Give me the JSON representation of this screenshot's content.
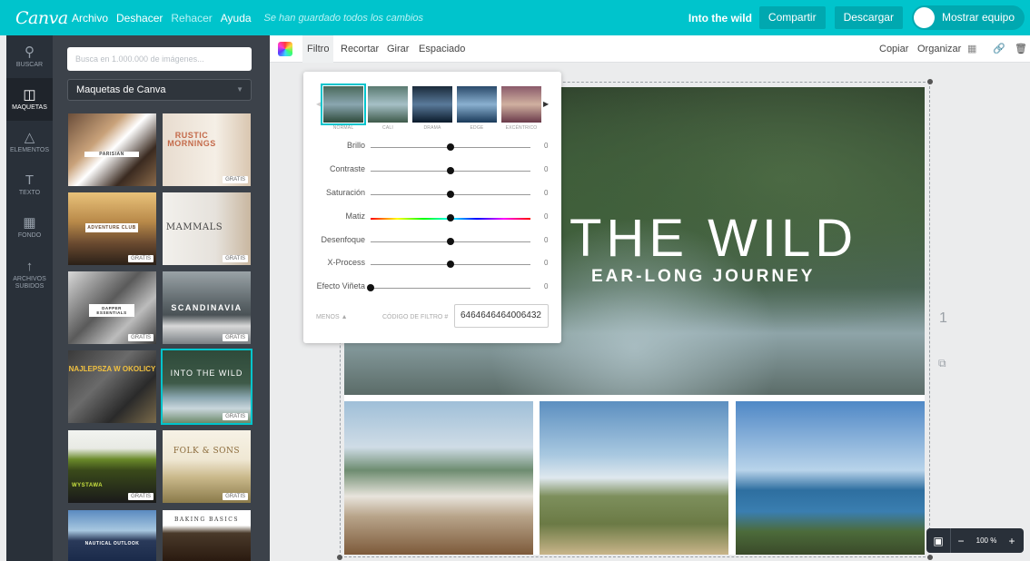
{
  "topbar": {
    "logo": "Canva",
    "menu": [
      "Archivo",
      "Deshacer",
      "Rehacer",
      "Ayuda"
    ],
    "saved_status": "Se han guardado todos los cambios",
    "doc_title": "Into the wild",
    "share": "Compartir",
    "download": "Descargar",
    "team": "Mostrar equipo"
  },
  "leftnav": [
    {
      "label": "BUSCAR",
      "icon": "search-icon"
    },
    {
      "label": "MAQUETAS",
      "icon": "layout-icon"
    },
    {
      "label": "ELEMENTOS",
      "icon": "shapes-icon"
    },
    {
      "label": "TEXTO",
      "icon": "text-icon"
    },
    {
      "label": "FONDO",
      "icon": "texture-icon"
    },
    {
      "label": "ARCHIVOS",
      "label2": "SUBIDOS",
      "icon": "upload-icon"
    }
  ],
  "panel": {
    "search_placeholder": "Busca en 1.000.000 de imágenes...",
    "select_value": "Maquetas de Canva",
    "badge": "GRATIS",
    "templates": [
      "PARISIAN",
      "RUSTIC MORNINGS",
      "ADVENTURE CLUB",
      "MAMMALS",
      "DAPPER ESSENTIALS",
      "SCANDINAVIA",
      "NAJLEPSZA W OKOLICY",
      "INTO THE WILD",
      "WYSTAWA",
      "FOLK & SONS",
      "NAUTICAL OUTLOOK",
      "BAKING BASICS"
    ]
  },
  "toolbar": {
    "filter": "Filtro",
    "crop": "Recortar",
    "rotate": "Girar",
    "spacing": "Espaciado",
    "copy": "Copiar",
    "arrange": "Organizar"
  },
  "filter_popup": {
    "filters": [
      "NORMAL",
      "CALI",
      "DRAMA",
      "EDGE",
      "EXCÉNTRICO"
    ],
    "sliders": [
      {
        "label": "Brillo",
        "value": "0",
        "level": 0.5
      },
      {
        "label": "Contraste",
        "value": "0",
        "level": 0.5
      },
      {
        "label": "Saturación",
        "value": "0",
        "level": 0.5
      },
      {
        "label": "Matiz",
        "value": "0",
        "level": 0.5
      },
      {
        "label": "Desenfoque",
        "value": "0",
        "level": 0.5
      },
      {
        "label": "X-Process",
        "value": "0",
        "level": 0.5
      },
      {
        "label": "Efecto Viñeta",
        "value": "0",
        "level": 0
      }
    ],
    "less": "MENOS ▲",
    "code_label": "CÓDIGO DE FILTRO #",
    "code_value": "6464646464006432"
  },
  "design": {
    "title": "THE WILD",
    "subtitle": "EAR-LONG JOURNEY"
  },
  "page_number": "1",
  "zoom": "100 %",
  "colors": {
    "brand": "#00c4cc",
    "nav": "#293039",
    "panel": "#3c424a"
  }
}
